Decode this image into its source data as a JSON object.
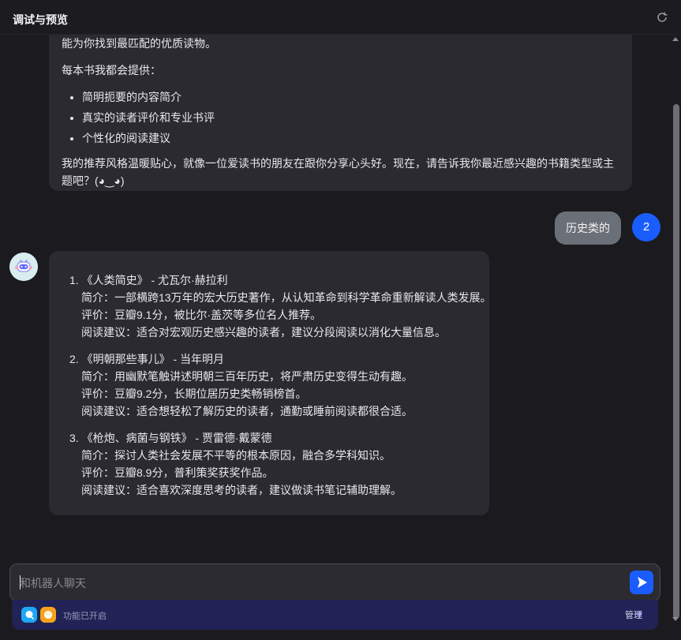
{
  "header": {
    "title": "调试与预览",
    "refresh_icon": "refresh-icon"
  },
  "conversation": {
    "first_bot_message": {
      "intro": "能为你找到最匹配的优质读物。",
      "offer_title": "每本书我都会提供：",
      "offers": [
        "简明扼要的内容简介",
        "真实的读者评价和专业书评",
        "个性化的阅读建议"
      ],
      "closing": "我的推荐风格温暖贴心，就像一位爱读书的朋友在跟你分享心头好。现在，请告诉我你最近感兴趣的书籍类型或主题吧？(◕‿◕)"
    },
    "user_message": {
      "text": "历史类的",
      "avatar_label": "2",
      "avatar_color": "#1a5dfc"
    },
    "bot_reply": {
      "books": [
        {
          "title": "1. 《人类简史》 - 尤瓦尔·赫拉利",
          "summary": "简介：一部横跨13万年的宏大历史著作，从认知革命到科学革命重新解读人类发展。",
          "rating": "评价：豆瓣9.1分，被比尔·盖茨等多位名人推荐。",
          "advice": "阅读建议：适合对宏观历史感兴趣的读者，建议分段阅读以消化大量信息。"
        },
        {
          "title": "2. 《明朝那些事儿》 - 当年明月",
          "summary": "简介：用幽默笔触讲述明朝三百年历史，将严肃历史变得生动有趣。",
          "rating": "评价：豆瓣9.2分，长期位居历史类畅销榜首。",
          "advice": "阅读建议：适合想轻松了解历史的读者，通勤或睡前阅读都很合适。"
        },
        {
          "title": "3. 《枪炮、病菌与钢铁》 - 贾雷德·戴蒙德",
          "summary": "简介：探讨人类社会发展不平等的根本原因，融合多学科知识。",
          "rating": "评价：豆瓣8.9分，普利策奖获奖作品。",
          "advice": "阅读建议：适合喜欢深度思考的读者，建议做读书笔记辅助理解。"
        }
      ]
    }
  },
  "composer": {
    "placeholder": "和机器人聊天",
    "value": "",
    "send_icon": "send-icon",
    "accent": "#1a5dfc"
  },
  "toolbar": {
    "status": "功能已开启",
    "manage_label": "管理",
    "background": "#212356"
  }
}
